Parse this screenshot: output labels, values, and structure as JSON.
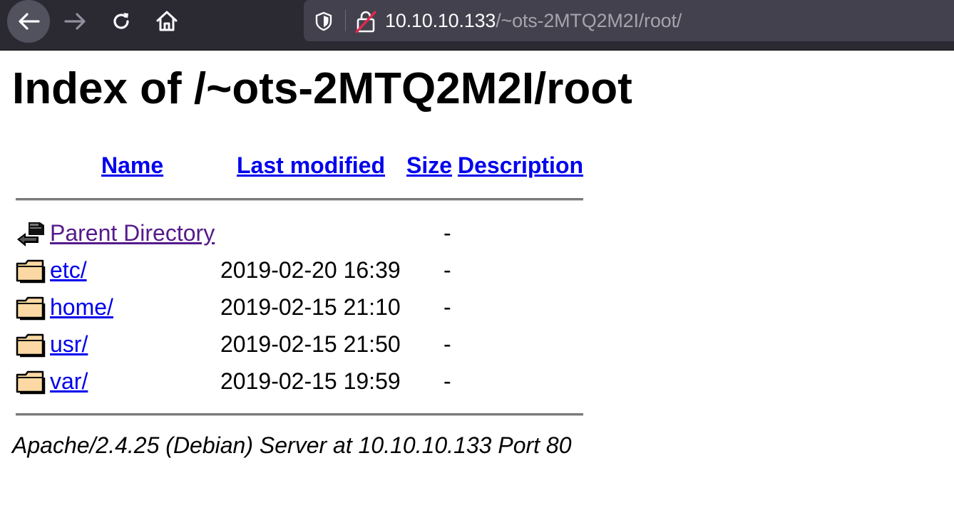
{
  "browser": {
    "url_host": "10.10.10.133",
    "url_path": "/~ots-2MTQ2M2I/root/",
    "icons": [
      "back-arrow-icon",
      "forward-arrow-icon",
      "reload-icon",
      "home-icon",
      "tracking-shield-icon",
      "insecure-lock-icon"
    ]
  },
  "page": {
    "title": "Index of /~ots-2MTQ2M2I/root",
    "columns": {
      "name": "Name",
      "last_modified": "Last modified",
      "size": "Size",
      "description": "Description"
    },
    "parent": {
      "label": "Parent Directory",
      "size": "-",
      "icon": "back-arrow-folder-icon"
    },
    "entries": [
      {
        "name": "etc/",
        "modified": "2019-02-20 16:39",
        "size": "-",
        "icon": "folder-icon"
      },
      {
        "name": "home/",
        "modified": "2019-02-15 21:10",
        "size": "-",
        "icon": "folder-icon"
      },
      {
        "name": "usr/",
        "modified": "2019-02-15 21:50",
        "size": "-",
        "icon": "folder-icon"
      },
      {
        "name": "var/",
        "modified": "2019-02-15 19:59",
        "size": "-",
        "icon": "folder-icon"
      }
    ],
    "footer": "Apache/2.4.25 (Debian) Server at 10.10.10.133 Port 80"
  },
  "colors": {
    "link": "#0000ee",
    "visited_link": "#551a8b",
    "toolbar": "#2b2a33",
    "urlbar": "#42414d"
  }
}
